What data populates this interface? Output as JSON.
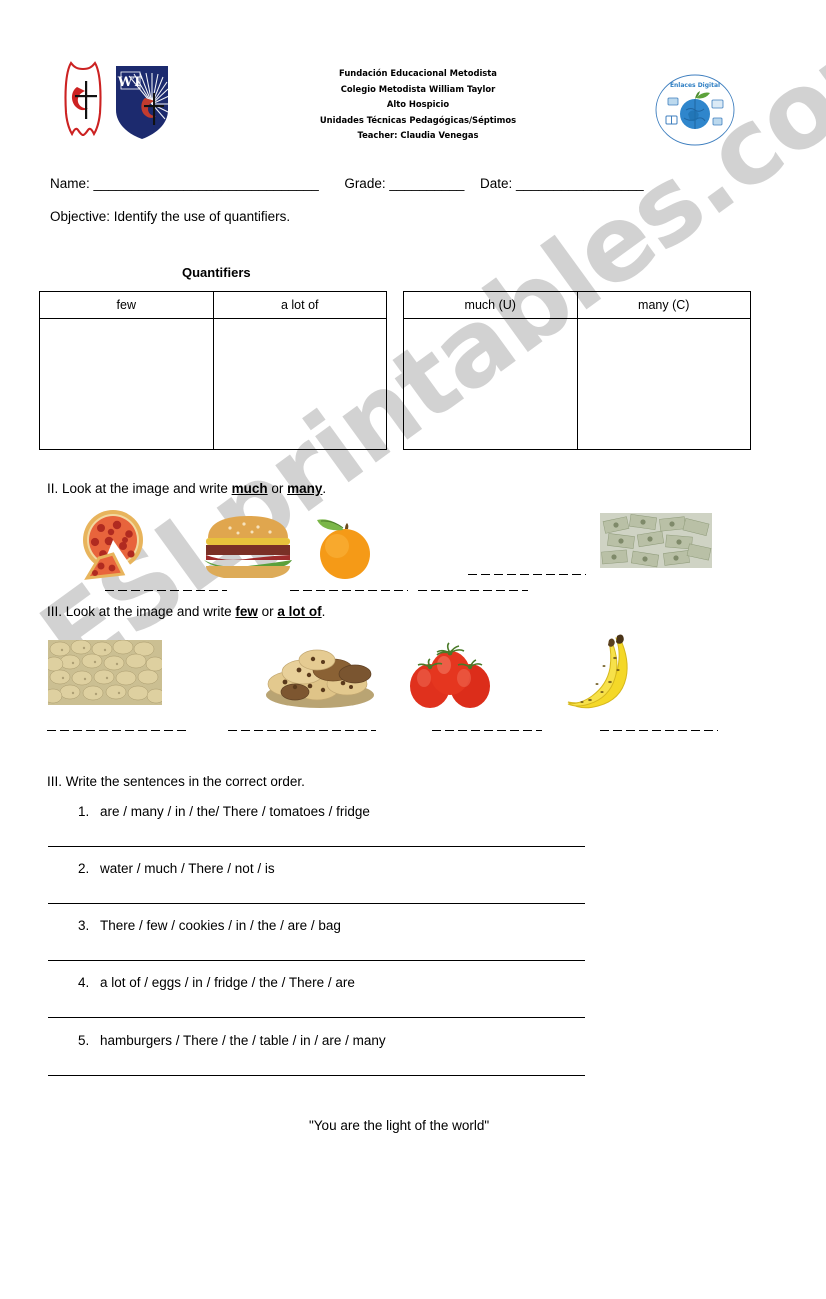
{
  "header": {
    "school_lines": [
      "Fundación Educacional Metodista",
      "Colegio Metodista William Taylor",
      "Alto Hospicio",
      "Unidades Técnicas Pedagógicas/Séptimos",
      "Teacher: Claudia Venegas"
    ],
    "logo_flame_name": "methodist-flame-cross-logo",
    "logo_shield_name": "william-taylor-shield-logo",
    "logo_digital_name": "enlaces-digital-apple-globe-logo",
    "logo_digital_caption": "Enlaces Digital",
    "shield_initials": "WT",
    "colors": {
      "flame_red": "#cc2222",
      "shield_navy": "#1c2a6e",
      "digital_blue": "#2288cc"
    }
  },
  "student_fields": {
    "name_label": "Name:",
    "name_rule": "______________________________",
    "grade_label": "Grade:",
    "grade_rule": "__________",
    "date_label": "Date:",
    "date_rule": "_________________"
  },
  "objective": "Objective: Identify the use of quantifiers.",
  "quantifiers_title": "Quantifiers",
  "tables": [
    {
      "name": "quantifiers-table-left",
      "headers": [
        "few",
        "a lot of"
      ]
    },
    {
      "name": "quantifiers-table-right",
      "headers": [
        "much (U)",
        "many (C)"
      ]
    }
  ],
  "section_two": {
    "prefix": "II. Look at the image and write ",
    "word_a": "much",
    "joiner": " or ",
    "word_b": "many",
    "suffix": ".",
    "images": [
      {
        "name": "pizza-image",
        "label": "pizza"
      },
      {
        "name": "hamburger-image",
        "label": "hamburger"
      },
      {
        "name": "orange-image",
        "label": "orange"
      },
      {
        "name": "money-image",
        "label": "money"
      }
    ]
  },
  "section_three": {
    "prefix": "III. Look at the image and write ",
    "word_a": "few",
    "joiner": " or ",
    "word_b": "a lot of",
    "suffix": ".",
    "images": [
      {
        "name": "potatoes-image",
        "label": "potatoes"
      },
      {
        "name": "cookies-image",
        "label": "cookies"
      },
      {
        "name": "tomatoes-image",
        "label": "tomatoes"
      },
      {
        "name": "bananas-image",
        "label": "bananas"
      }
    ]
  },
  "section_four": {
    "instruction": "III. Write the sentences in the correct order.",
    "sentences": [
      {
        "number": "1.",
        "text": "are / many / in / the/ There / tomatoes / fridge"
      },
      {
        "number": "2.",
        "text": "water / much / There / not / is"
      },
      {
        "number": "3.",
        "text": "There / few / cookies / in / the / are / bag"
      },
      {
        "number": "4.",
        "text": "a lot of / eggs / in / fridge / the / There / are"
      },
      {
        "number": "5.",
        "text": "hamburgers / There / the / table / in / are / many"
      }
    ]
  },
  "closing_quote": "\"You are the light of the world\"",
  "watermark": "ESLprintables.com"
}
